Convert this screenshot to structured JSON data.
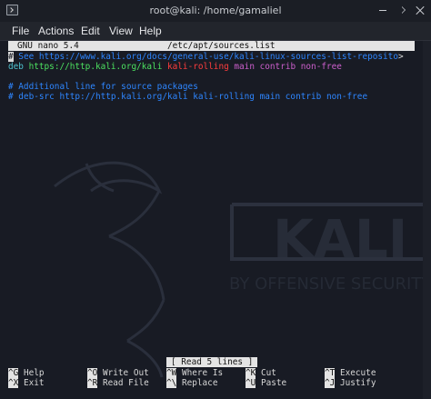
{
  "window": {
    "title": "root@kali: /home/gamaliel",
    "icons": {
      "app": "terminal-icon",
      "minimize": "minimize-icon",
      "maximize": "maximize-icon",
      "close": "close-icon"
    }
  },
  "menu": [
    "File",
    "Actions",
    "Edit",
    "View",
    "Help"
  ],
  "nano": {
    "version": "GNU nano 5.4",
    "filename": "/etc/apt/sources.list",
    "line1": {
      "cursor": "#",
      "text": " See https://www.kali.org/docs/general-use/kali-linux-sources-list-reposito",
      "overflow": ">"
    },
    "line2": {
      "keyword": "deb",
      "url": "https://http.kali.org/kali",
      "dist": "kali-rolling",
      "components": "main contrib non-free"
    },
    "line4": "# Additional line for source packages",
    "line5": "# deb-src http://http.kali.org/kali kali-rolling main contrib non-free",
    "status": "[ Read 5 lines ]",
    "shortcuts": [
      {
        "key": "^G",
        "label": "Help"
      },
      {
        "key": "^X",
        "label": "Exit"
      },
      {
        "key": "^O",
        "label": "Write Out"
      },
      {
        "key": "^R",
        "label": "Read File"
      },
      {
        "key": "^W",
        "label": "Where Is"
      },
      {
        "key": "^\\",
        "label": "Replace"
      },
      {
        "key": "^K",
        "label": "Cut"
      },
      {
        "key": "^U",
        "label": "Paste"
      },
      {
        "key": "^T",
        "label": "Execute"
      },
      {
        "key": "^J",
        "label": "Justify"
      }
    ]
  },
  "wallpaper": {
    "brand": "KALI",
    "tagline": "BY OFFENSIVE SECURITY"
  },
  "colors": {
    "comment": "#2e86ff",
    "deb": "#4ec3d0",
    "url": "#4ce060",
    "dist": "#ff3d3d",
    "components": "#cc5fcc"
  }
}
